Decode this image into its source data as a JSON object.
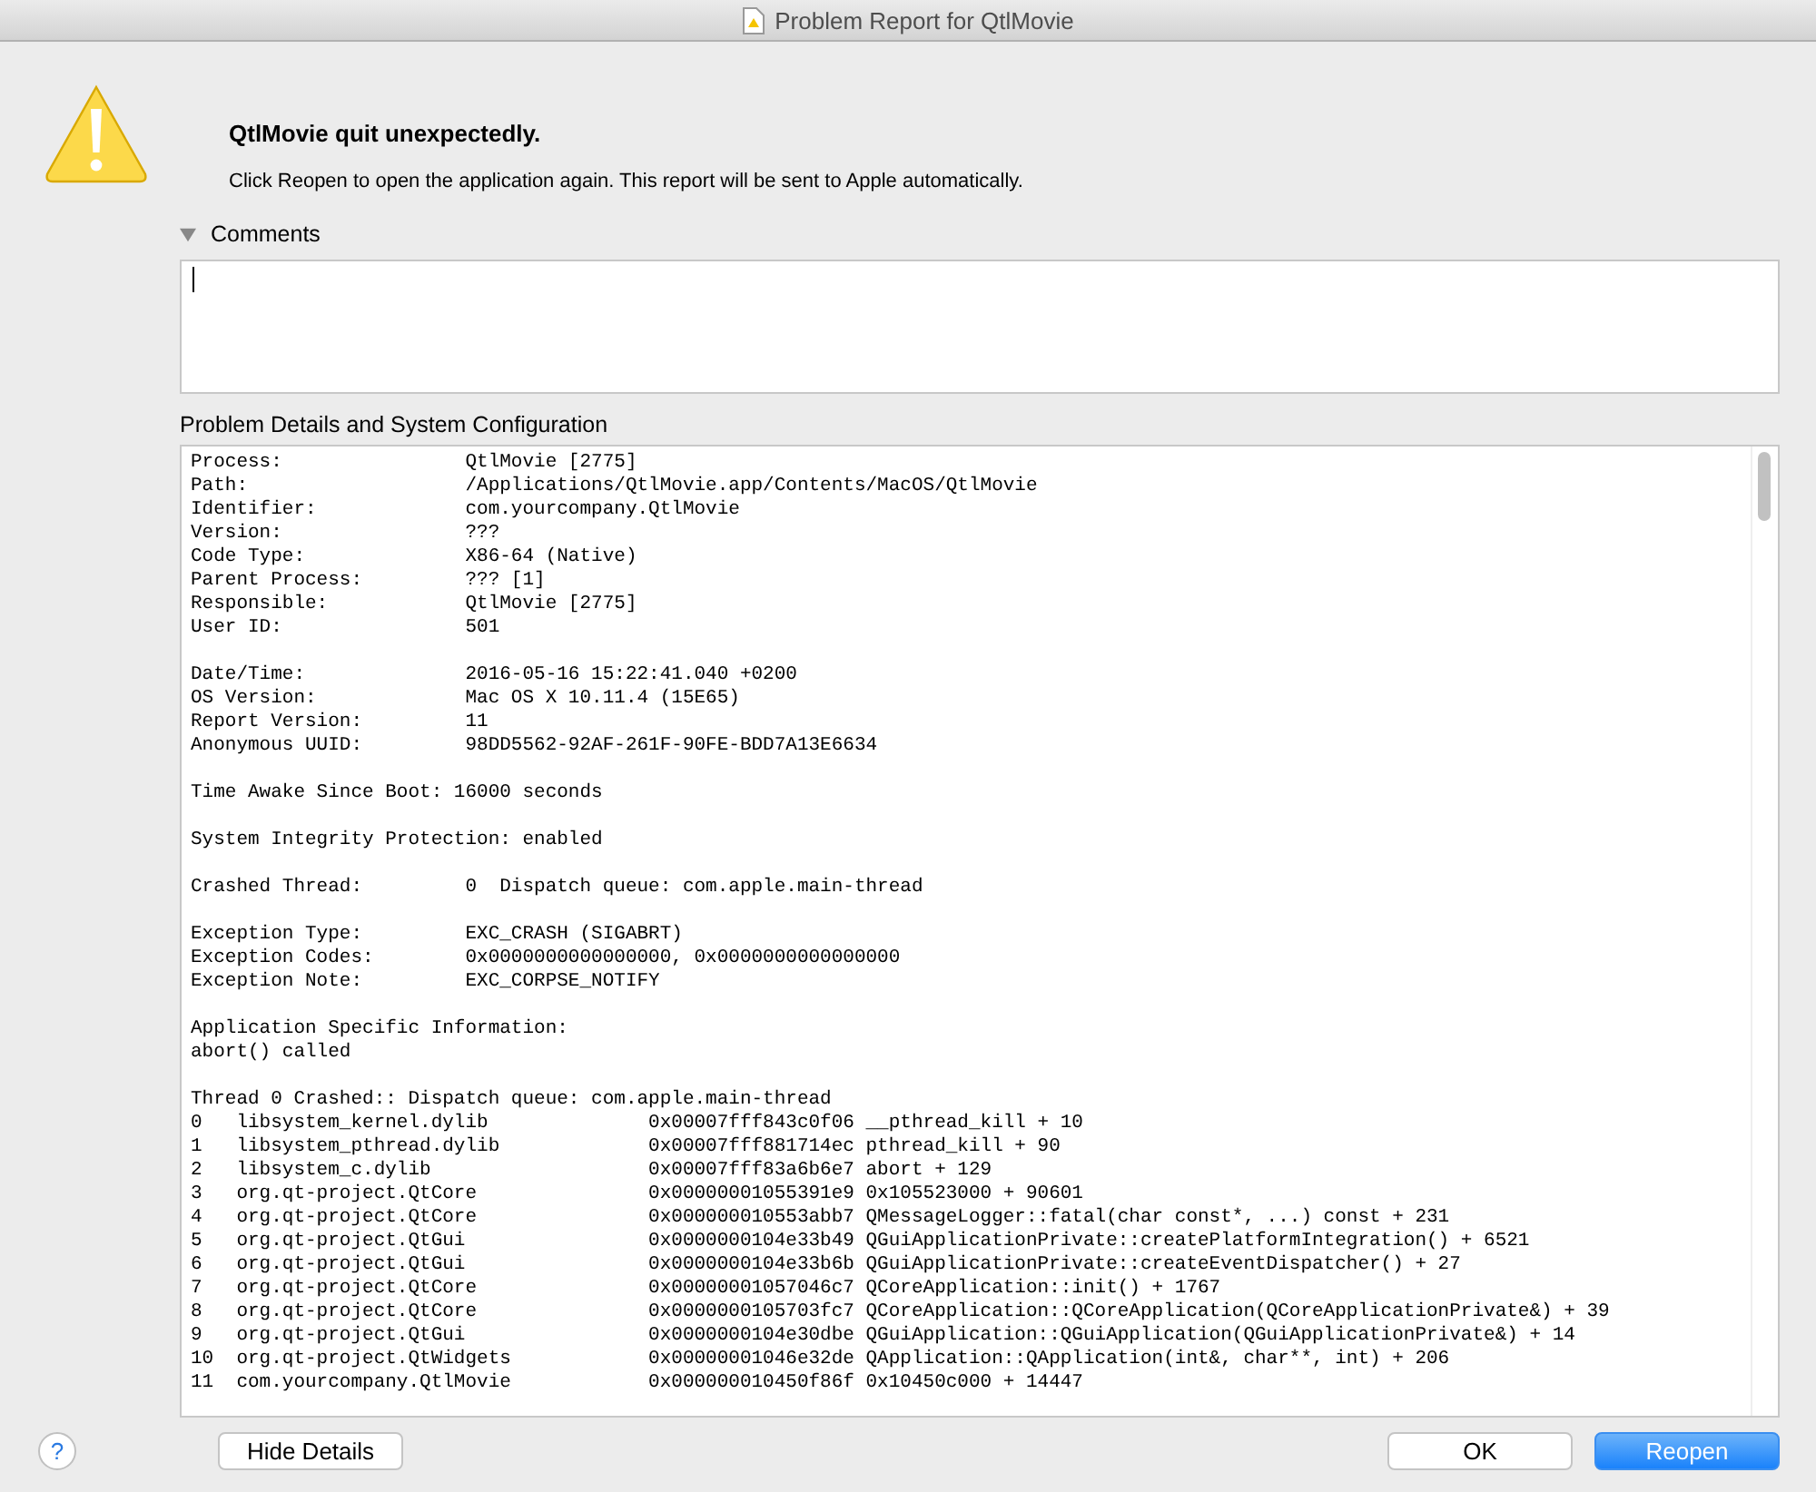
{
  "window": {
    "title": "Problem Report for QtlMovie"
  },
  "alert": {
    "heading": "QtlMovie quit unexpectedly.",
    "message": "Click Reopen to open the application again. This report will be sent to Apple automatically."
  },
  "comments": {
    "label": "Comments",
    "expanded": true
  },
  "details": {
    "label": "Problem Details and System Configuration",
    "sections": [
      {
        "lines": [
          {
            "kind": "kv",
            "cells": [
              "Process:",
              "QtlMovie [2775]"
            ]
          },
          {
            "kind": "kv",
            "cells": [
              "Path:",
              "/Applications/QtlMovie.app/Contents/MacOS/QtlMovie"
            ]
          },
          {
            "kind": "kv",
            "cells": [
              "Identifier:",
              "com.yourcompany.QtlMovie"
            ]
          },
          {
            "kind": "kv",
            "cells": [
              "Version:",
              "???"
            ]
          },
          {
            "kind": "kv",
            "cells": [
              "Code Type:",
              "X86-64 (Native)"
            ]
          },
          {
            "kind": "kv",
            "cells": [
              "Parent Process:",
              "??? [1]"
            ]
          },
          {
            "kind": "kv",
            "cells": [
              "Responsible:",
              "QtlMovie [2775]"
            ]
          },
          {
            "kind": "kv",
            "cells": [
              "User ID:",
              "501"
            ]
          }
        ]
      },
      {
        "lines": [
          {
            "kind": "kv",
            "cells": [
              "Date/Time:",
              "2016-05-16 15:22:41.040 +0200"
            ]
          },
          {
            "kind": "kv",
            "cells": [
              "OS Version:",
              "Mac OS X 10.11.4 (15E65)"
            ]
          },
          {
            "kind": "kv",
            "cells": [
              "Report Version:",
              "11"
            ]
          },
          {
            "kind": "kv",
            "cells": [
              "Anonymous UUID:",
              "98DD5562-92AF-261F-90FE-BDD7A13E6634"
            ]
          }
        ]
      },
      {
        "lines": [
          {
            "kind": "text",
            "cells": [
              "Time Awake Since Boot: 16000 seconds"
            ]
          }
        ]
      },
      {
        "lines": [
          {
            "kind": "text",
            "cells": [
              "System Integrity Protection: enabled"
            ]
          }
        ]
      },
      {
        "lines": [
          {
            "kind": "kv",
            "cells": [
              "Crashed Thread:",
              "0  Dispatch queue: com.apple.main-thread"
            ]
          }
        ]
      },
      {
        "lines": [
          {
            "kind": "kv",
            "cells": [
              "Exception Type:",
              "EXC_CRASH (SIGABRT)"
            ]
          },
          {
            "kind": "kv",
            "cells": [
              "Exception Codes:",
              "0x0000000000000000, 0x0000000000000000"
            ]
          },
          {
            "kind": "kv",
            "cells": [
              "Exception Note:",
              "EXC_CORPSE_NOTIFY"
            ]
          }
        ]
      },
      {
        "lines": [
          {
            "kind": "text",
            "cells": [
              "Application Specific Information:"
            ]
          },
          {
            "kind": "text",
            "cells": [
              "abort() called"
            ]
          }
        ]
      },
      {
        "lines": [
          {
            "kind": "text",
            "cells": [
              "Thread 0 Crashed:: Dispatch queue: com.apple.main-thread"
            ]
          },
          {
            "kind": "frame",
            "cells": [
              "0",
              "libsystem_kernel.dylib",
              "0x00007fff843c0f06",
              "__pthread_kill + 10"
            ]
          },
          {
            "kind": "frame",
            "cells": [
              "1",
              "libsystem_pthread.dylib",
              "0x00007fff881714ec",
              "pthread_kill + 90"
            ]
          },
          {
            "kind": "frame",
            "cells": [
              "2",
              "libsystem_c.dylib",
              "0x00007fff83a6b6e7",
              "abort + 129"
            ]
          },
          {
            "kind": "frame",
            "cells": [
              "3",
              "org.qt-project.QtCore",
              "0x00000001055391e9",
              "0x105523000 + 90601"
            ]
          },
          {
            "kind": "frame",
            "cells": [
              "4",
              "org.qt-project.QtCore",
              "0x000000010553abb7",
              "QMessageLogger::fatal(char const*, ...) const + 231"
            ]
          },
          {
            "kind": "frame",
            "cells": [
              "5",
              "org.qt-project.QtGui",
              "0x0000000104e33b49",
              "QGuiApplicationPrivate::createPlatformIntegration() + 6521"
            ]
          },
          {
            "kind": "frame",
            "cells": [
              "6",
              "org.qt-project.QtGui",
              "0x0000000104e33b6b",
              "QGuiApplicationPrivate::createEventDispatcher() + 27"
            ]
          },
          {
            "kind": "frame",
            "cells": [
              "7",
              "org.qt-project.QtCore",
              "0x00000001057046c7",
              "QCoreApplication::init() + 1767"
            ]
          },
          {
            "kind": "frame",
            "cells": [
              "8",
              "org.qt-project.QtCore",
              "0x0000000105703fc7",
              "QCoreApplication::QCoreApplication(QCoreApplicationPrivate&) + 39"
            ]
          },
          {
            "kind": "frame",
            "cells": [
              "9",
              "org.qt-project.QtGui",
              "0x0000000104e30dbe",
              "QGuiApplication::QGuiApplication(QGuiApplicationPrivate&) + 14"
            ]
          },
          {
            "kind": "frame",
            "cells": [
              "10",
              "org.qt-project.QtWidgets",
              "0x00000001046e32de",
              "QApplication::QApplication(int&, char**, int) + 206"
            ]
          },
          {
            "kind": "frame",
            "cells": [
              "11",
              "com.yourcompany.QtlMovie",
              "0x000000010450f86f",
              "0x10450c000 + 14447"
            ]
          }
        ]
      }
    ]
  },
  "buttons": {
    "help": "?",
    "toggle_details": "Hide Details",
    "ok": "OK",
    "reopen": "Reopen"
  }
}
